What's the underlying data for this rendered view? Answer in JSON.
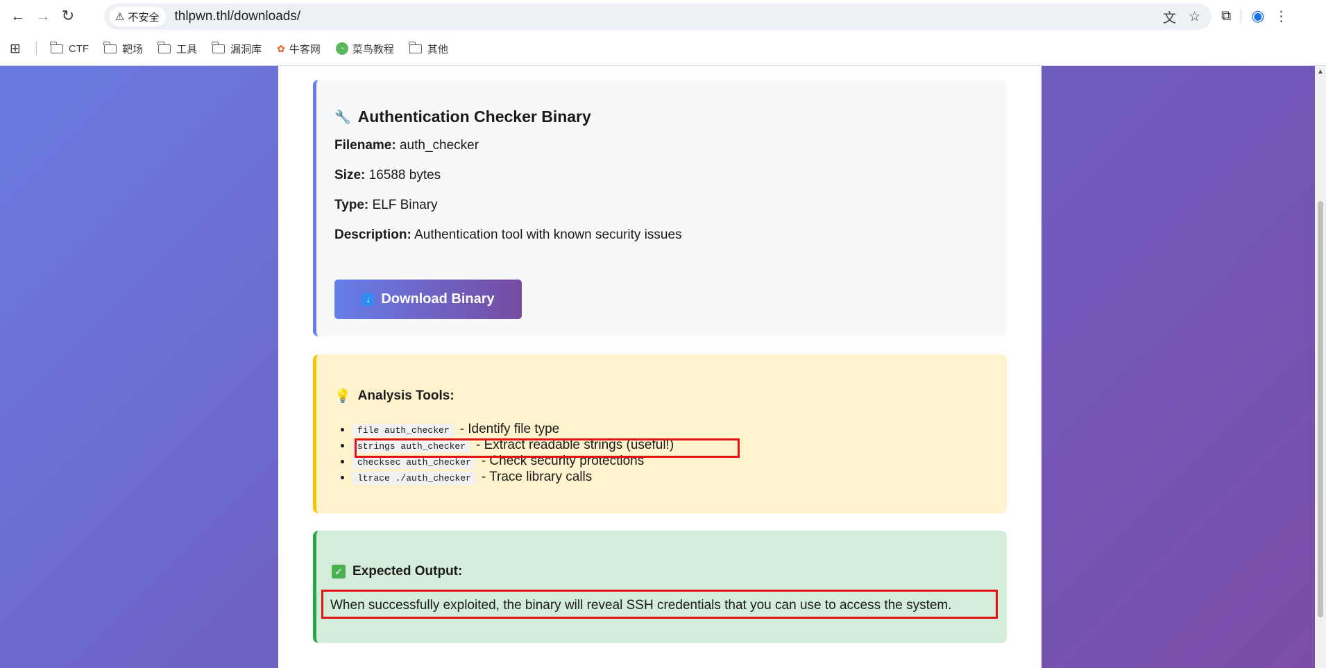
{
  "browser": {
    "security_label": "不安全",
    "url": "thlpwn.thl/downloads/",
    "bookmarks": [
      {
        "label": "CTF",
        "icon": "folder-icon"
      },
      {
        "label": "靶场",
        "icon": "folder-icon"
      },
      {
        "label": "工具",
        "icon": "folder-icon"
      },
      {
        "label": "漏洞库",
        "icon": "folder-icon"
      },
      {
        "label": "牛客网",
        "icon": "niuke-icon"
      },
      {
        "label": "菜鸟教程",
        "icon": "runoob-icon"
      },
      {
        "label": "其他",
        "icon": "folder-icon"
      }
    ]
  },
  "binary": {
    "title": "Authentication Checker Binary",
    "filename_label": "Filename:",
    "filename": "auth_checker",
    "size_label": "Size:",
    "size": "16588 bytes",
    "type_label": "Type:",
    "type": "ELF Binary",
    "description_label": "Description:",
    "description": "Authentication tool with known security issues",
    "download_label": "Download Binary"
  },
  "tools": {
    "title": "Analysis Tools:",
    "items": [
      {
        "cmd": "file auth_checker",
        "desc": "- Identify file type"
      },
      {
        "cmd": "strings auth_checker",
        "desc": "- Extract readable strings (useful!)"
      },
      {
        "cmd": "checksec auth_checker",
        "desc": "- Check security protections"
      },
      {
        "cmd": "ltrace ./auth_checker",
        "desc": "- Trace library calls"
      }
    ]
  },
  "output": {
    "title": "Expected Output:",
    "text": "When successfully exploited, the binary will reveal SSH credentials that you can use to access the system."
  },
  "colors": {
    "accent": "#667eea",
    "tools_border": "#ffc107",
    "output_border": "#28a745",
    "highlight": "#e41313"
  }
}
